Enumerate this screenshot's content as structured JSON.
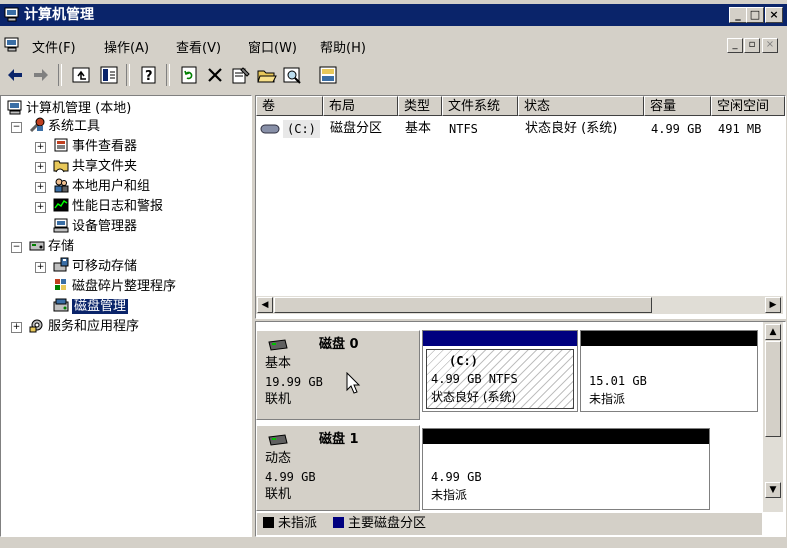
{
  "window": {
    "title": "计算机管理",
    "min_label": "_",
    "max_label": "□",
    "close_label": "×"
  },
  "menu": [
    {
      "label": "文件(F)"
    },
    {
      "label": "操作(A)"
    },
    {
      "label": "查看(V)"
    },
    {
      "label": "窗口(W)"
    },
    {
      "label": "帮助(H)"
    }
  ],
  "tree": {
    "root": "计算机管理 (本地)",
    "system_tools": "系统工具",
    "event_viewer": "事件查看器",
    "shared_folders": "共享文件夹",
    "local_users": "本地用户和组",
    "perf_logs": "性能日志和警报",
    "device_manager": "设备管理器",
    "storage": "存储",
    "removable": "可移动存储",
    "defrag": "磁盘碎片整理程序",
    "disk_mgmt": "磁盘管理",
    "services": "服务和应用程序"
  },
  "volumes": {
    "columns": [
      "卷",
      "布局",
      "类型",
      "文件系统",
      "状态",
      "容量",
      "空闲空间"
    ],
    "rows": [
      {
        "volume": "(C:)",
        "layout": "磁盘分区",
        "type": "基本",
        "fs": "NTFS",
        "status": "状态良好 (系统)",
        "capacity": "4.99 GB",
        "free": "491 MB"
      }
    ]
  },
  "disks": [
    {
      "name": "磁盘 0",
      "type": "基本",
      "size": "19.99 GB",
      "state": "联机",
      "partitions": [
        {
          "label": "(C:)",
          "size_fs": "4.99 GB NTFS",
          "status": "状态良好 (系统)",
          "bar_color": "#00007f"
        },
        {
          "size": "15.01 GB",
          "status": "未指派",
          "bar_color": "#000000"
        }
      ]
    },
    {
      "name": "磁盘 1",
      "type": "动态",
      "size": "4.99 GB",
      "state": "联机",
      "partitions": [
        {
          "size": "4.99 GB",
          "status": "未指派",
          "bar_color": "#000000"
        }
      ]
    }
  ],
  "legend": [
    {
      "label": "未指派",
      "color": "#000000"
    },
    {
      "label": "主要磁盘分区",
      "color": "#00007f"
    }
  ],
  "colors": {
    "titlebar": "#0a246a",
    "face": "#d4d0c8",
    "primary_partition": "#00007f",
    "unallocated": "#000000"
  }
}
